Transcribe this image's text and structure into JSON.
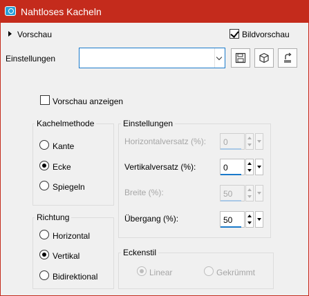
{
  "window": {
    "title": "Nahtloses Kacheln"
  },
  "preview_section": {
    "label": "Vorschau",
    "bildvorschau_label": "Bildvorschau",
    "bildvorschau_checked": true
  },
  "settings_row": {
    "label": "Einstellungen",
    "selected_value": ""
  },
  "toolbar": {
    "save_icon": "save-icon",
    "cube_icon": "cube-icon",
    "reset_icon": "reset-icon"
  },
  "show_preview": {
    "label": "Vorschau anzeigen",
    "checked": false
  },
  "kachelmethode": {
    "title": "Kachelmethode",
    "options": [
      {
        "label": "Kante",
        "checked": false
      },
      {
        "label": "Ecke",
        "checked": true
      },
      {
        "label": "Spiegeln",
        "checked": false
      }
    ]
  },
  "richtung": {
    "title": "Richtung",
    "options": [
      {
        "label": "Horizontal",
        "checked": false
      },
      {
        "label": "Vertikal",
        "checked": true
      },
      {
        "label": "Bidirektional",
        "checked": false
      }
    ]
  },
  "einstellungen": {
    "title": "Einstellungen",
    "fields": [
      {
        "label": "Horizontalversatz (%):",
        "value": "0",
        "enabled": false
      },
      {
        "label": "Vertikalversatz (%):",
        "value": "0",
        "enabled": true
      },
      {
        "label": "Breite (%):",
        "value": "50",
        "enabled": false
      },
      {
        "label": "Übergang (%):",
        "value": "50",
        "enabled": true
      }
    ]
  },
  "eckenstil": {
    "title": "Eckenstil",
    "options": [
      {
        "label": "Linear",
        "checked": true,
        "enabled": false
      },
      {
        "label": "Gekrümmt",
        "checked": false,
        "enabled": false
      }
    ]
  },
  "colors": {
    "title_bar": "#c42b1c",
    "accent": "#1979ca",
    "background": "#f0f0f0"
  }
}
